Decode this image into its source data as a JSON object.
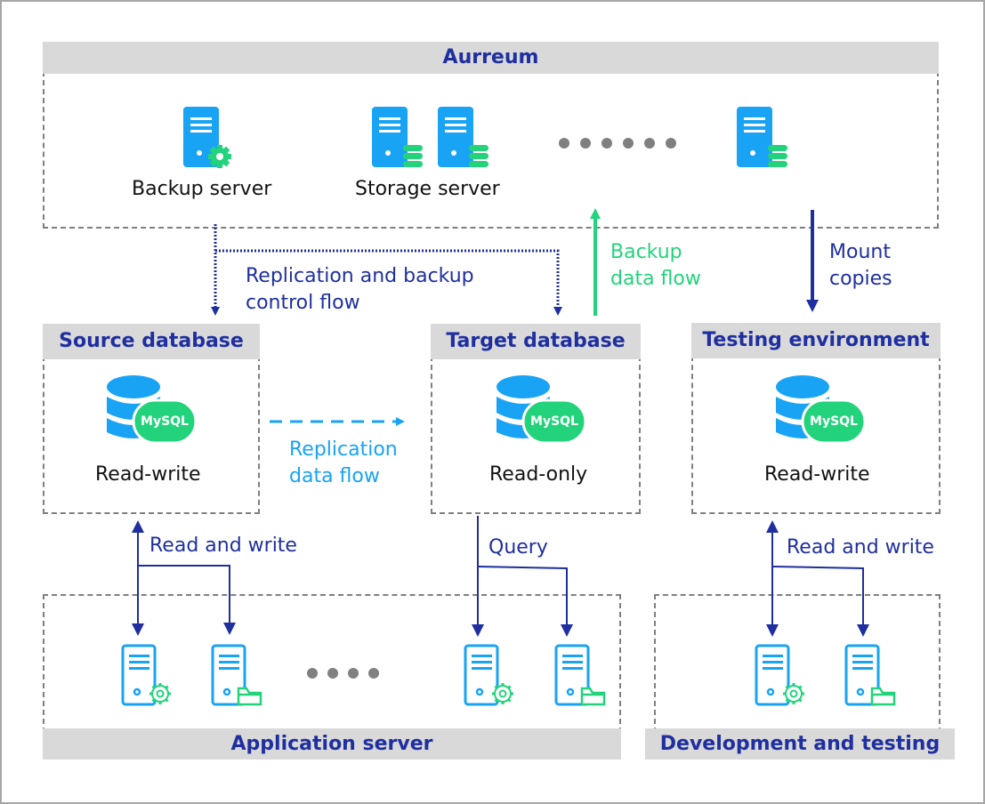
{
  "colors": {
    "navy": "#1f2f9f",
    "blue": "#18a3f5",
    "green": "#23d37c",
    "header_bg": "#d9d9d9",
    "dash_border": "#7f7f7f",
    "dot": "#808080"
  },
  "aurreum": {
    "title": "Aurreum",
    "backup_server_label": "Backup server",
    "storage_server_label": "Storage server",
    "ellipsis_count": 6
  },
  "flows": {
    "replication_backup_control": [
      "Replication and backup",
      "control flow"
    ],
    "backup_data_flow": [
      "Backup",
      "data flow"
    ],
    "mount_copies": [
      "Mount",
      "copies"
    ],
    "replication_data_flow": [
      "Replication",
      "data flow"
    ],
    "read_write_left": "Read and write",
    "query": "Query",
    "read_write_right": "Read and write"
  },
  "source_db": {
    "title": "Source database",
    "badge": "MySQL",
    "mode": "Read-write"
  },
  "target_db": {
    "title": "Target database",
    "badge": "MySQL",
    "mode": "Read-only"
  },
  "testing_env": {
    "title": "Testing environment",
    "badge": "MySQL",
    "mode": "Read-write"
  },
  "application_server": {
    "title": "Application server",
    "ellipsis_count": 4
  },
  "dev_testing": {
    "title": "Development and testing"
  }
}
